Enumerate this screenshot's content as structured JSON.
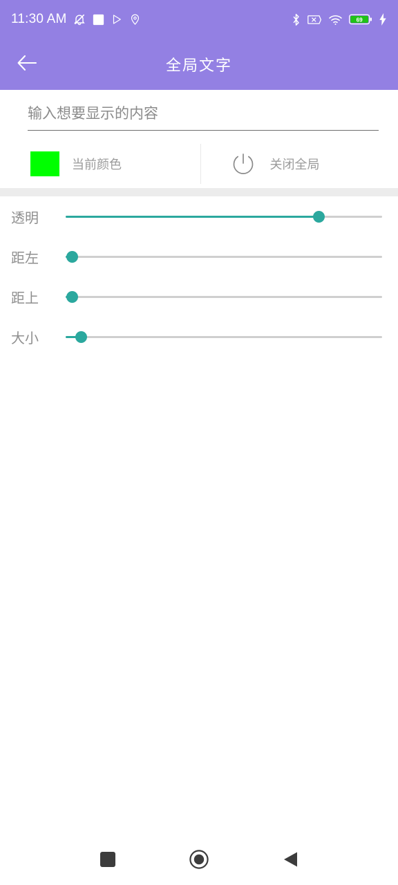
{
  "statusbar": {
    "time": "11:30 AM",
    "left_icons": [
      "bell-mute-icon",
      "white-square-icon",
      "play-store-icon",
      "location-pin-icon"
    ],
    "right_icons": [
      "bluetooth-icon",
      "sim-x-icon",
      "wifi-icon",
      "battery-icon",
      "charging-bolt-icon"
    ],
    "battery_level": "69",
    "battery_color": "#21c217"
  },
  "appbar": {
    "title": "全局文字",
    "back_icon": "arrow-left-icon",
    "background": "#9380e3"
  },
  "input": {
    "value": "",
    "placeholder": "输入想要显示的内容"
  },
  "actions": {
    "color": {
      "label": "当前颜色",
      "swatch_color": "#00ff00",
      "icon": "color-swatch-icon"
    },
    "power": {
      "label": "关闭全局",
      "icon": "power-icon"
    }
  },
  "sliders": {
    "accent_color": "#2ba89e",
    "track_color": "#cfcfcf",
    "items": [
      {
        "label": "透明",
        "value": 80
      },
      {
        "label": "距左",
        "value": 2
      },
      {
        "label": "距上",
        "value": 2
      },
      {
        "label": "大小",
        "value": 5
      }
    ]
  },
  "navbar": {
    "buttons": [
      {
        "name": "recents-button",
        "icon": "square-icon"
      },
      {
        "name": "home-button",
        "icon": "circle-icon"
      },
      {
        "name": "back-button",
        "icon": "triangle-left-icon"
      }
    ]
  }
}
